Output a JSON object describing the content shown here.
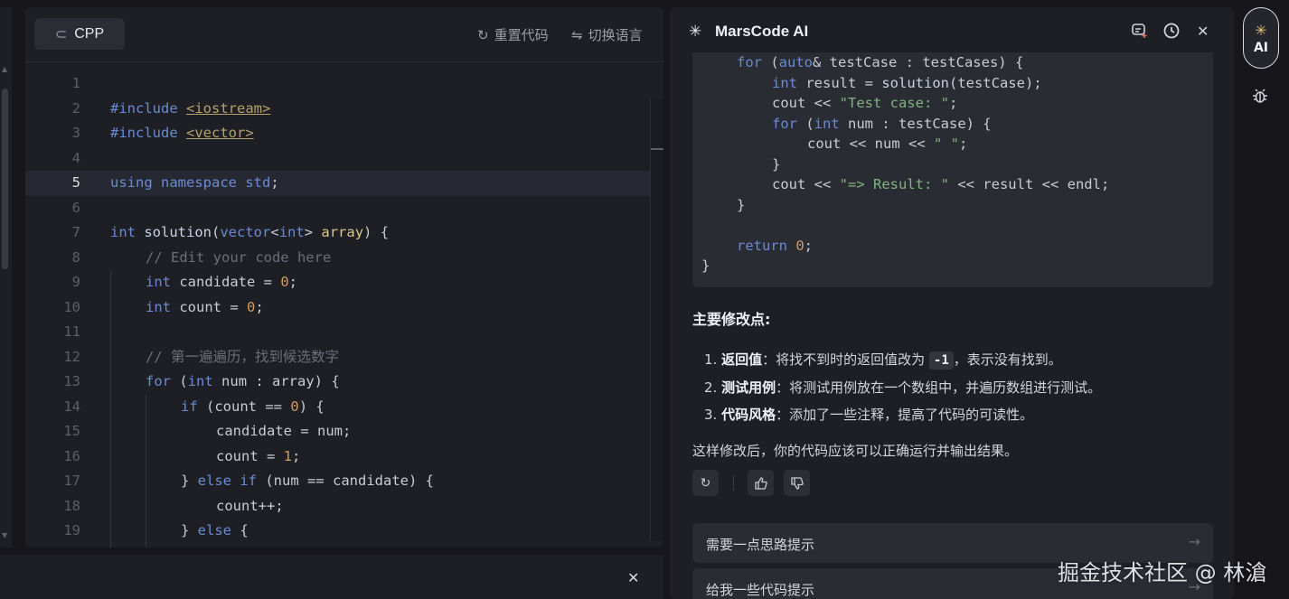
{
  "editor": {
    "language_tab": {
      "label": "CPP",
      "icon": "cpp-language-icon"
    },
    "reset_code": {
      "label": "重置代码",
      "icon": "refresh-icon"
    },
    "switch_language": {
      "label": "切换语言",
      "icon": "swap-icon"
    },
    "active_line": 5,
    "lines": [
      {
        "n": "1",
        "active": false
      },
      {
        "n": "2",
        "active": false
      },
      {
        "n": "3",
        "active": false
      },
      {
        "n": "4",
        "active": false
      },
      {
        "n": "5",
        "active": true
      },
      {
        "n": "6",
        "active": false
      },
      {
        "n": "7",
        "active": false
      },
      {
        "n": "8",
        "active": false
      },
      {
        "n": "9",
        "active": false
      },
      {
        "n": "10",
        "active": false
      },
      {
        "n": "11",
        "active": false
      },
      {
        "n": "12",
        "active": false
      },
      {
        "n": "13",
        "active": false
      },
      {
        "n": "14",
        "active": false
      },
      {
        "n": "15",
        "active": false
      },
      {
        "n": "16",
        "active": false
      },
      {
        "n": "17",
        "active": false
      },
      {
        "n": "18",
        "active": false
      },
      {
        "n": "19",
        "active": false
      }
    ],
    "code": {
      "l2_directive": "#include",
      "l2_header": "<iostream>",
      "l3_directive": "#include",
      "l3_header": "<vector>",
      "l5_using": "using namespace",
      "l5_std": "std",
      "l5_semi": ";",
      "l7_int": "int",
      "l7_fn": "solution",
      "l7_paren": "(",
      "l7_vector": "vector",
      "l7_lt": "<",
      "l7_int2": "int",
      "l7_gt": ">",
      "l7_arg": "array",
      "l7_end": ") {",
      "l8_comment": "// Edit your code here",
      "l9_int": "int",
      "l9_rest": "candidate = ",
      "l9_num": "0",
      "l9_semi": ";",
      "l10_int": "int",
      "l10_rest": "count = ",
      "l10_num": "0",
      "l10_semi": ";",
      "l12_comment": "// 第一遍遍历，找到候选数字",
      "l13_for": "for",
      "l13_open": "(",
      "l13_int": "int",
      "l13_rest": "num : array) {",
      "l14_if": "if",
      "l14_rest": "(count == ",
      "l14_num": "0",
      "l14_end": ") {",
      "l15_text": "candidate = num;",
      "l16_text": "count = ",
      "l16_num": "1",
      "l16_semi": ";",
      "l17_brace": "} ",
      "l17_else": "else if",
      "l17_rest": "(num == candidate) {",
      "l18_text": "count++;",
      "l19_brace": "} ",
      "l19_else": "else",
      "l19_end": " {"
    },
    "bottom_close_icon": "close-icon"
  },
  "ai_panel": {
    "title": "MarsCode AI",
    "logo_icon": "sparkle-icon",
    "header_icons": [
      "new-chat-icon",
      "history-icon",
      "close-icon"
    ],
    "code_block": {
      "c1_for": "for",
      "c1_open": " (",
      "c1_auto": "auto",
      "c1_rest": "& testCase : testCases) {",
      "c2_int": "int",
      "c2_rest": " result = ",
      "c2_fn": "solution",
      "c2_end": "(testCase);",
      "c3_cout": "cout << ",
      "c3_str": "\"Test case: \"",
      "c3_semi": ";",
      "c4_for": "for",
      "c4_open": " (",
      "c4_int": "int",
      "c4_rest": " num : testCase) {",
      "c5_text": "cout << num << ",
      "c5_str": "\" \"",
      "c5_semi": ";",
      "c6_text": "}",
      "c7_cout": "cout << ",
      "c7_str": "\"=> Result: \"",
      "c7_rest": " << result << endl;",
      "c8_text": "}",
      "c9_return": "return",
      "c9_num": " 0",
      "c9_semi": ";",
      "c10_text": "}"
    },
    "summary_title": "主要修改点:",
    "summary_items": [
      {
        "num": "1.",
        "bold": "返回值",
        "text": "：将找不到时的返回值改为",
        "code": "-1",
        "text2": "，表示没有找到。"
      },
      {
        "num": "2.",
        "bold": "测试用例",
        "text": "：将测试用例放在一个数组中，并遍历数组进行测试。"
      },
      {
        "num": "3.",
        "bold": "代码风格",
        "text": "：添加了一些注释，提高了代码的可读性。"
      }
    ],
    "conclusion": "这样修改后，你的代码应该可以正确运行并输出结果。",
    "feedback_icons": [
      "regenerate-icon",
      "thumbs-up-icon",
      "thumbs-down-icon"
    ],
    "suggestions": [
      {
        "label": "需要一点思路提示",
        "arrow": "→"
      },
      {
        "label": "给我一些代码提示",
        "arrow": "→"
      }
    ]
  },
  "right_rail": {
    "ai_button_label": "AI",
    "ai_icon": "ai-sparkle-icon",
    "bug_icon": "bug-icon"
  },
  "watermark": "掘金技术社区 @ 林滄"
}
